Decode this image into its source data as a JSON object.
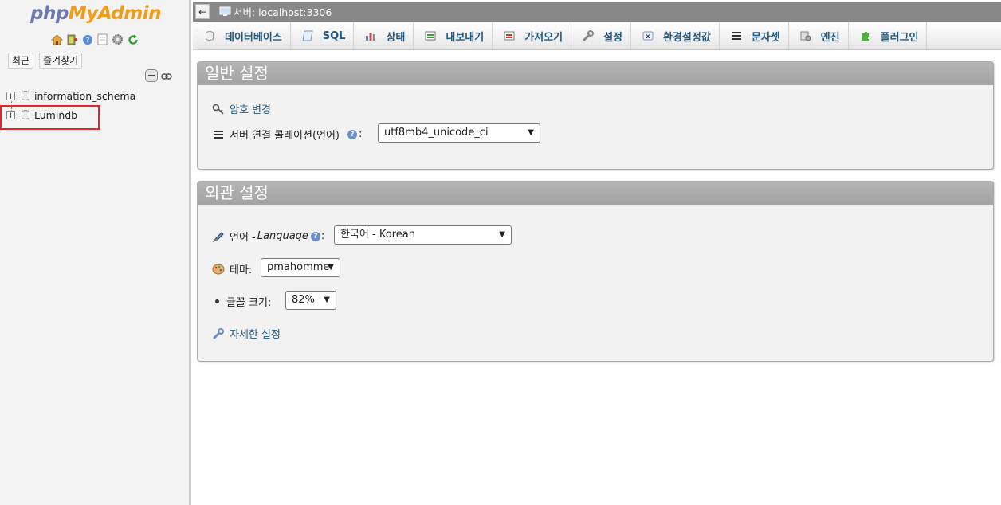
{
  "nav": {
    "logo_php": "php",
    "logo_myadmin": "MyAdmin",
    "icons": [
      "home-icon",
      "logout-icon",
      "help-icon",
      "docs-icon",
      "settings-icon",
      "reload-icon"
    ],
    "recent_label": "최근",
    "favorites_label": "즐겨찾기",
    "databases": [
      "information_schema",
      "Lumindb"
    ]
  },
  "topbar": {
    "back_label": "←",
    "breadcrumb": "서버: localhost:3306"
  },
  "tabs": [
    {
      "label": "데이터베이스",
      "icon": "database-icon"
    },
    {
      "label": "SQL",
      "icon": "sql-icon"
    },
    {
      "label": "상태",
      "icon": "status-icon"
    },
    {
      "label": "내보내기",
      "icon": "export-icon"
    },
    {
      "label": "가져오기",
      "icon": "import-icon"
    },
    {
      "label": "설정",
      "icon": "wrench-icon"
    },
    {
      "label": "환경설정값",
      "icon": "variables-icon"
    },
    {
      "label": "문자셋",
      "icon": "charset-icon"
    },
    {
      "label": "엔진",
      "icon": "engine-icon"
    },
    {
      "label": "플러그인",
      "icon": "plugin-icon"
    }
  ],
  "general": {
    "title": "일반 설정",
    "change_password": "암호 변경",
    "collation_label": "서버 연결 콜레이션(언어)",
    "collation_value": "utf8mb4_unicode_ci"
  },
  "appearance": {
    "title": "외관 설정",
    "language_label": "언어 - ",
    "language_italic": "Language",
    "language_value": "한국어 - Korean",
    "theme_label": "테마:",
    "theme_value": "pmahomme",
    "fontsize_label": "글꼴 크기:",
    "fontsize_value": "82%",
    "more_settings": "자세한 설정"
  },
  "colors": {
    "link": "#235a81",
    "highlight": "#e2262d",
    "panel_header": "#a8a8a8",
    "topbar": "#888888"
  }
}
